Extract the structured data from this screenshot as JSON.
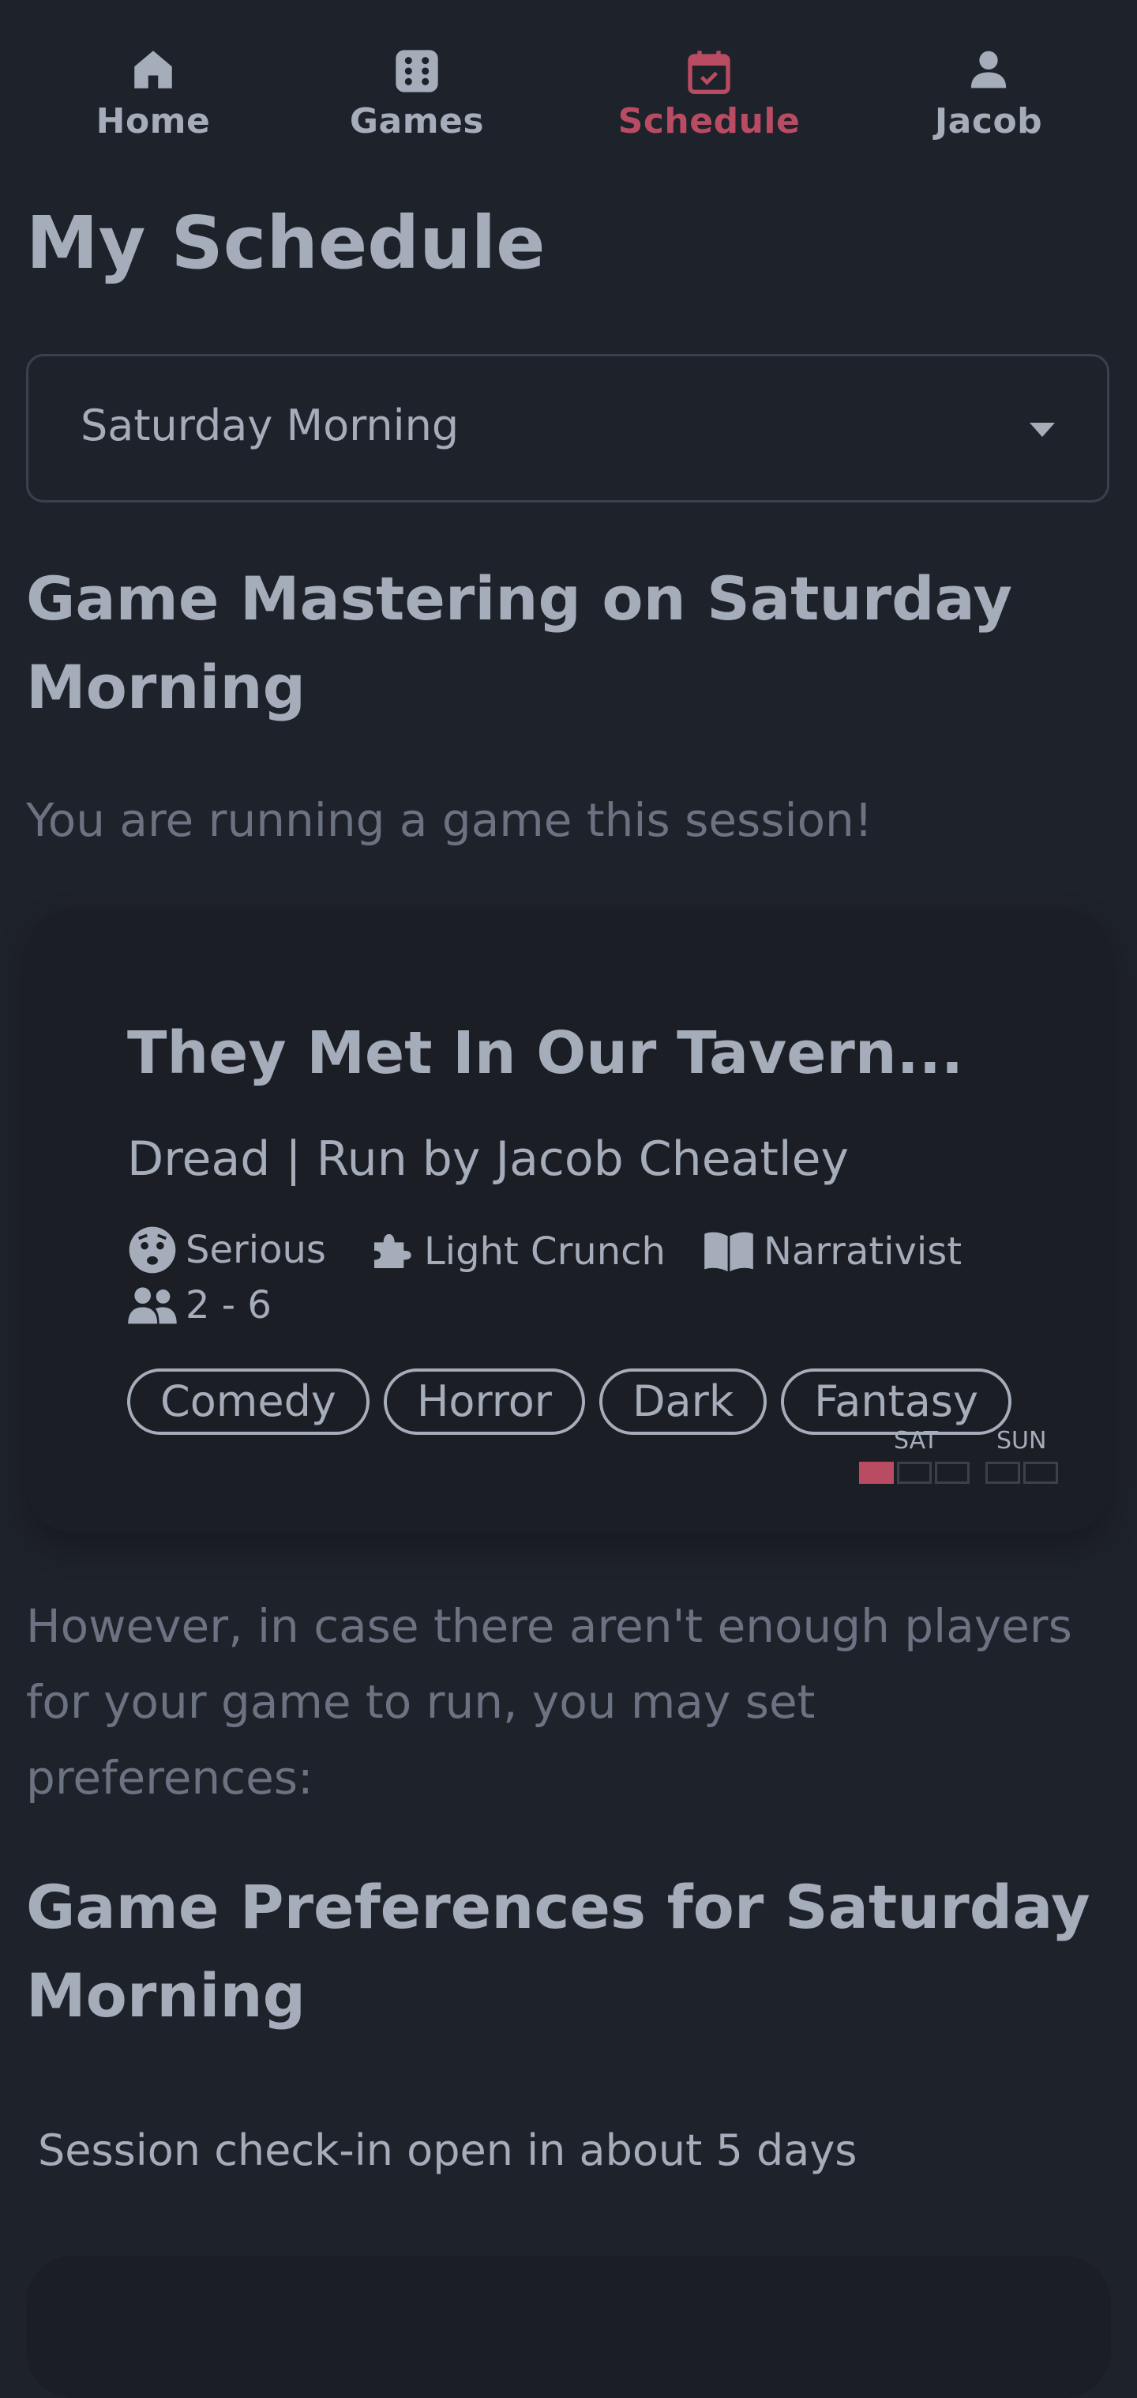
{
  "nav": {
    "items": [
      {
        "label": "Home",
        "icon": "home-icon"
      },
      {
        "label": "Games",
        "icon": "dice-icon"
      },
      {
        "label": "Schedule",
        "icon": "calendar-check-icon",
        "active": true
      },
      {
        "label": "Jacob",
        "icon": "user-icon"
      }
    ]
  },
  "page": {
    "title": "My Schedule",
    "session_select": {
      "value": "Saturday Morning"
    },
    "gm_heading": "Game Mastering on Saturday Morning",
    "gm_message": "You are running a game this session!",
    "game": {
      "title": "They Met In Our Tavern...",
      "subtitle": "Dread | Run by Jacob Cheatley",
      "tone": "Serious",
      "crunch": "Light Crunch",
      "style": "Narrativist",
      "players": "2 - 6",
      "tags": [
        "Comedy",
        "Horror",
        "Dark",
        "Fantasy"
      ],
      "schedule": {
        "days": [
          "SAT",
          "SUN"
        ],
        "sat_slots": [
          true,
          false,
          false
        ],
        "sun_slots": [
          false,
          false
        ]
      }
    },
    "fallback_message": "However, in case there aren't enough players for your game to run, you may set preferences:",
    "pref_heading": "Game Preferences for Saturday Morning",
    "checkin": "Session check-in open in about 5 days"
  },
  "colors": {
    "background": "#1e222a",
    "card": "#1b1e24",
    "text": "#a5acba",
    "muted": "#6b7281",
    "accent": "#b94c63"
  }
}
